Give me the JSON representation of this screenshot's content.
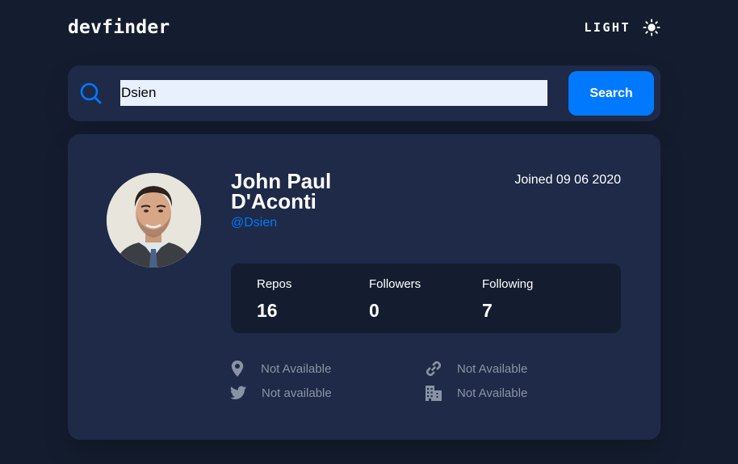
{
  "header": {
    "logo": "devfinder",
    "theme_label": "LIGHT",
    "theme_icon": "sun-icon"
  },
  "search": {
    "value": "Dsien",
    "placeholder": "",
    "button_label": "Search",
    "icon": "search-icon"
  },
  "profile": {
    "name": "John Paul D'Aconti",
    "username": "@Dsien",
    "joined": "Joined 09 06 2020",
    "avatar": "avatar-photo"
  },
  "stats": [
    {
      "label": "Repos",
      "value": "16"
    },
    {
      "label": "Followers",
      "value": "0"
    },
    {
      "label": "Following",
      "value": "7"
    }
  ],
  "links": {
    "location": {
      "icon": "location-pin-icon",
      "text": "Not Available"
    },
    "twitter": {
      "icon": "twitter-icon",
      "text": "Not available"
    },
    "website": {
      "icon": "link-icon",
      "text": "Not Available"
    },
    "company": {
      "icon": "building-icon",
      "text": "Not Available"
    }
  },
  "colors": {
    "background": "#141d2f",
    "card": "#1e2a47",
    "accent": "#0079ff",
    "muted": "#8a93a6"
  }
}
